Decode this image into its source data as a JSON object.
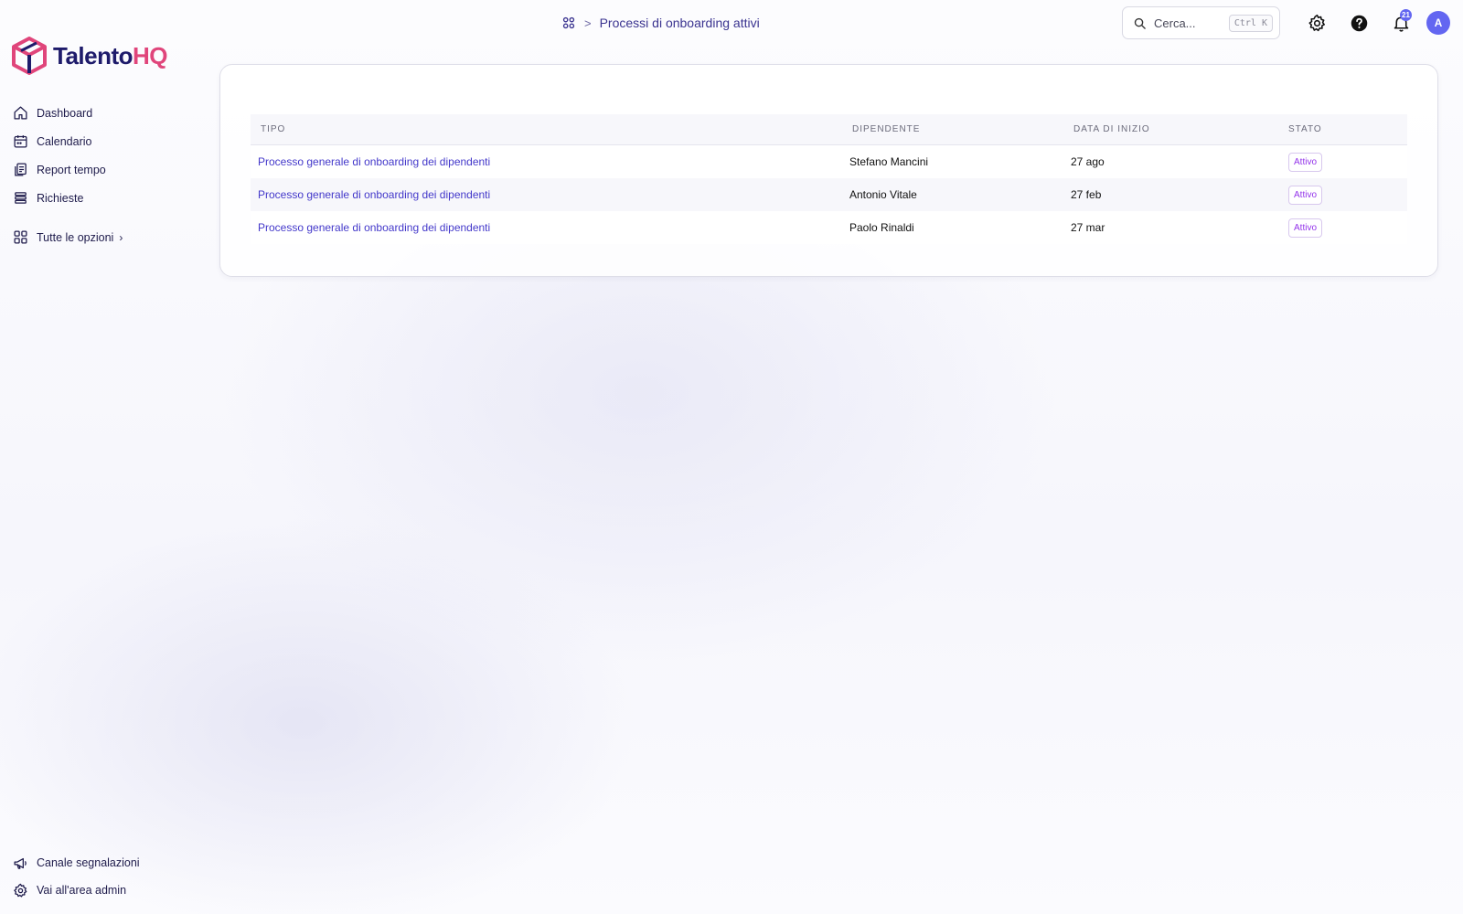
{
  "app": {
    "logo_part1": "Talento",
    "logo_part2": "HQ",
    "accent_color": "#6366f1",
    "brand_pink": "#e0457b",
    "brand_navy": "#1e1b6b"
  },
  "sidebar": {
    "items": [
      {
        "label": "Dashboard",
        "icon": "home-icon"
      },
      {
        "label": "Calendario",
        "icon": "calendar-icon"
      },
      {
        "label": "Report tempo",
        "icon": "report-icon"
      },
      {
        "label": "Richieste",
        "icon": "list-icon"
      }
    ],
    "all_options": {
      "label": "Tutte le opzioni",
      "icon": "grid-icon",
      "chevron": "›"
    },
    "bottom": [
      {
        "label": "Canale segnalazioni",
        "icon": "megaphone-icon"
      },
      {
        "label": "Vai all'area admin",
        "icon": "gear-icon"
      }
    ]
  },
  "header": {
    "breadcrumb": {
      "icon": "apps-icon",
      "separator": ">",
      "title": "Processi di onboarding attivi"
    },
    "search": {
      "placeholder": "Cerca...",
      "shortcut": "Ctrl K"
    },
    "icons": [
      "gear-icon",
      "help-icon",
      "bell-icon"
    ],
    "notifications_count": "21",
    "avatar_initial": "A"
  },
  "table": {
    "columns": [
      "TIPO",
      "DIPENDENTE",
      "DATA DI INIZIO",
      "STATO"
    ],
    "rows": [
      {
        "tipo": "Processo generale di onboarding dei dipendenti",
        "dipendente": "Stefano Mancini",
        "data": "27 ago",
        "stato": "Attivo"
      },
      {
        "tipo": "Processo generale di onboarding dei dipendenti",
        "dipendente": "Antonio Vitale",
        "data": "27 feb",
        "stato": "Attivo"
      },
      {
        "tipo": "Processo generale di onboarding dei dipendenti",
        "dipendente": "Paolo Rinaldi",
        "data": "27 mar",
        "stato": "Attivo"
      }
    ]
  }
}
